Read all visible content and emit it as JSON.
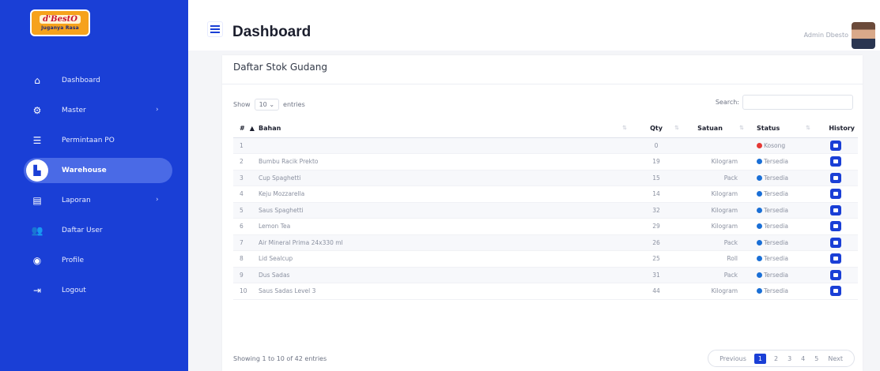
{
  "brand": {
    "name": "d'BestO",
    "tagline": "Juganya Rasa"
  },
  "sidebar": {
    "items": [
      {
        "label": "Dashboard",
        "icon": "home-icon",
        "glyph": "⌂",
        "arrow": ""
      },
      {
        "label": "Master",
        "icon": "gears-icon",
        "glyph": "⚙",
        "arrow": "›"
      },
      {
        "label": "Permintaan PO",
        "icon": "list-icon",
        "glyph": "☰",
        "arrow": ""
      },
      {
        "label": "Warehouse",
        "icon": "warehouse-icon",
        "glyph": "▙",
        "arrow": ""
      },
      {
        "label": "Laporan",
        "icon": "database-icon",
        "glyph": "▤",
        "arrow": "›"
      },
      {
        "label": "Daftar User",
        "icon": "users-icon",
        "glyph": "👥",
        "arrow": ""
      },
      {
        "label": "Profile",
        "icon": "user-circle-icon",
        "glyph": "◉",
        "arrow": ""
      },
      {
        "label": "Logout",
        "icon": "logout-icon",
        "glyph": "⇥",
        "arrow": ""
      }
    ],
    "active_index": 3,
    "colors": {
      "bg": "#1a3fd6",
      "active": "#4a6ae6"
    }
  },
  "header": {
    "title": "Dashboard",
    "user": "Admin Dbesto"
  },
  "card": {
    "title": "Daftar Stok Gudang",
    "show_label": "Show",
    "entries_value": "10",
    "entries_label": "entries",
    "search_label": "Search:",
    "search_value": ""
  },
  "table": {
    "headers": {
      "no": "#",
      "bahan": "Bahan",
      "qty": "Qty",
      "satuan": "Satuan",
      "status": "Status",
      "history": "History"
    },
    "rows": [
      {
        "no": "1",
        "bahan": "",
        "qty": "0",
        "satuan": "",
        "status": "Kosong",
        "status_color": "#e53935"
      },
      {
        "no": "2",
        "bahan": "Bumbu Racik Prekto",
        "qty": "19",
        "satuan": "Kilogram",
        "status": "Tersedia",
        "status_color": "#1a6fd6"
      },
      {
        "no": "3",
        "bahan": "Cup Spaghetti",
        "qty": "15",
        "satuan": "Pack",
        "status": "Tersedia",
        "status_color": "#1a6fd6"
      },
      {
        "no": "4",
        "bahan": "Keju Mozzarella",
        "qty": "14",
        "satuan": "Kilogram",
        "status": "Tersedia",
        "status_color": "#1a6fd6"
      },
      {
        "no": "5",
        "bahan": "Saus Spaghetti",
        "qty": "32",
        "satuan": "Kilogram",
        "status": "Tersedia",
        "status_color": "#1a6fd6"
      },
      {
        "no": "6",
        "bahan": "Lemon Tea",
        "qty": "29",
        "satuan": "Kilogram",
        "status": "Tersedia",
        "status_color": "#1a6fd6"
      },
      {
        "no": "7",
        "bahan": "Air Mineral Prima 24x330 ml",
        "qty": "26",
        "satuan": "Pack",
        "status": "Tersedia",
        "status_color": "#1a6fd6"
      },
      {
        "no": "8",
        "bahan": "Lid Sealcup",
        "qty": "25",
        "satuan": "Roll",
        "status": "Tersedia",
        "status_color": "#1a6fd6"
      },
      {
        "no": "9",
        "bahan": "Dus Sadas",
        "qty": "31",
        "satuan": "Pack",
        "status": "Tersedia",
        "status_color": "#1a6fd6"
      },
      {
        "no": "10",
        "bahan": "Saus Sadas Level 3",
        "qty": "44",
        "satuan": "Kilogram",
        "status": "Tersedia",
        "status_color": "#1a6fd6"
      }
    ]
  },
  "footer": {
    "info": "Showing 1 to 10 of 42 entries",
    "previous": "Previous",
    "pages": [
      "1",
      "2",
      "3",
      "4",
      "5"
    ],
    "current_page": "1",
    "next": "Next"
  }
}
